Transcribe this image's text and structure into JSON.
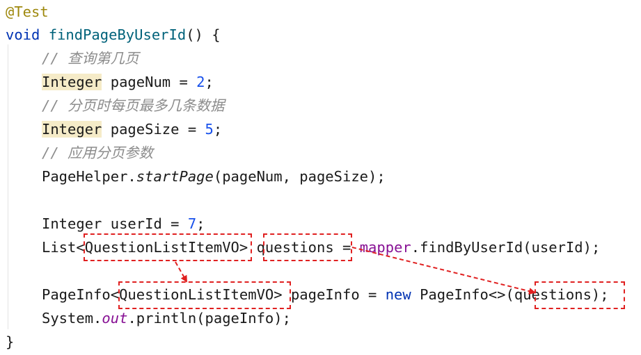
{
  "code": {
    "annotation": "@Test",
    "method_kw": "void",
    "method_name": "findPageByUserId",
    "method_rest": "() {",
    "comment_page_num": "查询第几页",
    "page_num_type": "Integer",
    "page_num_decl": " pageNum = ",
    "page_num_value": "2",
    "comment_page_size": "分页时每页最多几条数据",
    "page_size_type": "Integer",
    "page_size_decl": " pageSize = ",
    "page_size_value": "5",
    "comment_apply": "应用分页参数",
    "helper_class": "PageHelper.",
    "helper_method": "startPage",
    "helper_args": "(pageNum, pageSize);",
    "user_id_decl": "Integer userId = ",
    "user_id_value": "7",
    "list_prefix": "List<",
    "list_generic": "QuestionListItemVO",
    "list_gt": ">",
    "list_var": "questions",
    "list_eq": " = ",
    "mapper_field": "mapper",
    "mapper_call": ".findByUserId(userId);",
    "pageinfo_prefix": "PageInfo<",
    "pageinfo_generic": "QuestionListItemVO",
    "pageinfo_mid": "> pageInfo = ",
    "new_kw": "new",
    "pageinfo_ctor": " PageInfo<>",
    "ctor_arg": "(questions)",
    "stmt_end": ";",
    "sys_prefix": "System.",
    "sys_out": "out",
    "sys_rest": ".println(pageInfo);",
    "close_brace": "}"
  },
  "colors": {
    "annotation": "#9e880d",
    "keyword": "#0033b3",
    "method": "#00627a",
    "number": "#1750eb",
    "comment": "#8c8c8c",
    "field": "#871094",
    "type_highlight": "#f5ebc8",
    "markup_red": "#e02020"
  }
}
